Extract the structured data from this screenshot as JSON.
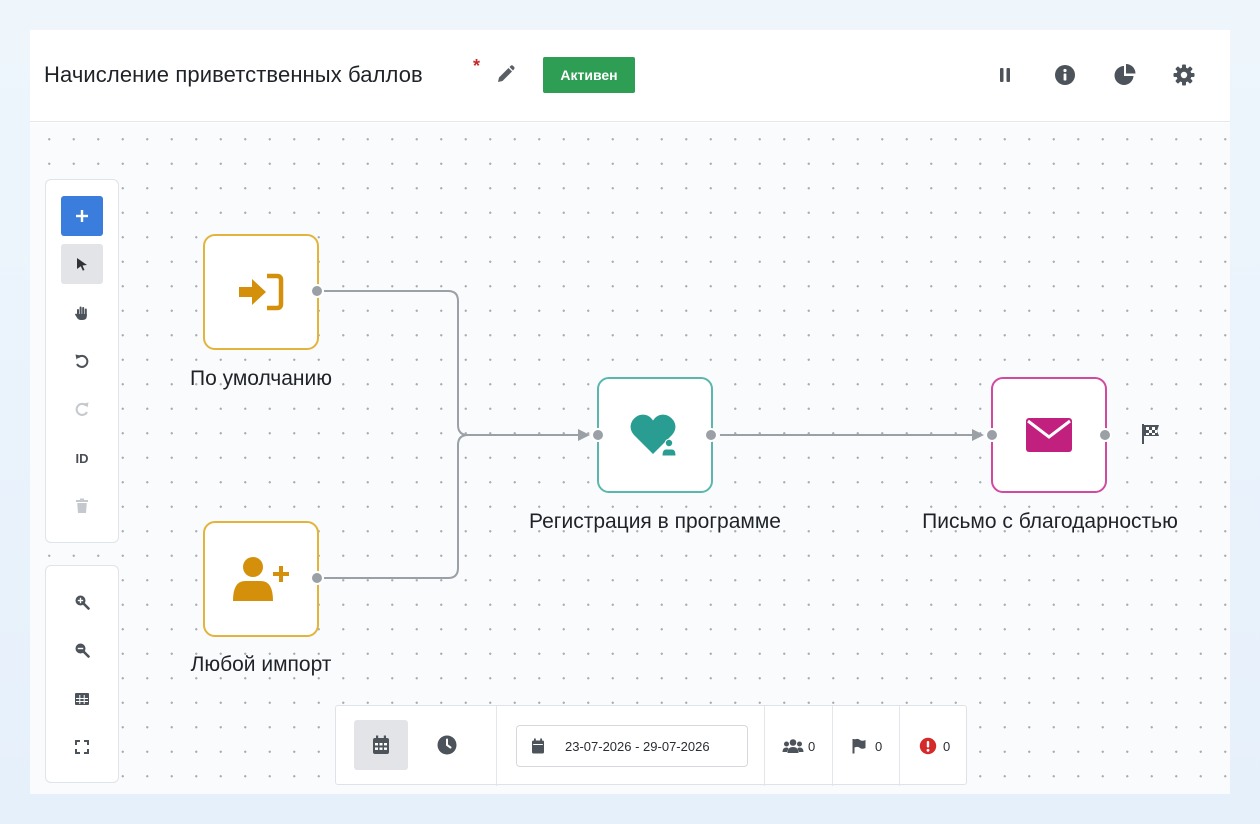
{
  "header": {
    "title": "Начисление приветственных баллов",
    "required_mark": "*",
    "status_badge": "Активен"
  },
  "toolbar": {
    "id_label": "ID"
  },
  "nodes": {
    "default_entry": {
      "label": "По умолчанию"
    },
    "any_import": {
      "label": "Любой импорт"
    },
    "registration": {
      "label": "Регистрация в программе"
    },
    "thank_you_email": {
      "label": "Письмо с благодарностью"
    }
  },
  "bottombar": {
    "date_range": "23-07-2026 - 29-07-2026",
    "participants_count": "0",
    "goals_count": "0",
    "errors_count": "0"
  },
  "colors": {
    "accent_blue": "#3b7ddd",
    "status_green": "#2e9e55",
    "entry_orange": "#d4900a",
    "registration_teal": "#2a9d92",
    "email_magenta": "#c2207f",
    "error_red": "#d42a2a"
  },
  "icons": {
    "header": [
      "pencil-icon",
      "pause-icon",
      "info-icon",
      "chart-pie-icon",
      "gear-icon"
    ],
    "toolbar": [
      "plus-icon",
      "pointer-icon",
      "hand-icon",
      "undo-icon",
      "redo-icon",
      "trash-icon",
      "zoom-in-icon",
      "zoom-out-icon",
      "grid-icon",
      "fullscreen-icon"
    ],
    "nodes": [
      "sign-in-icon",
      "user-plus-icon",
      "heart-user-icon",
      "envelope-icon",
      "finish-flag-icon"
    ],
    "bottombar": [
      "calendar-icon",
      "clock-icon",
      "users-icon",
      "flag-icon",
      "error-icon"
    ]
  }
}
